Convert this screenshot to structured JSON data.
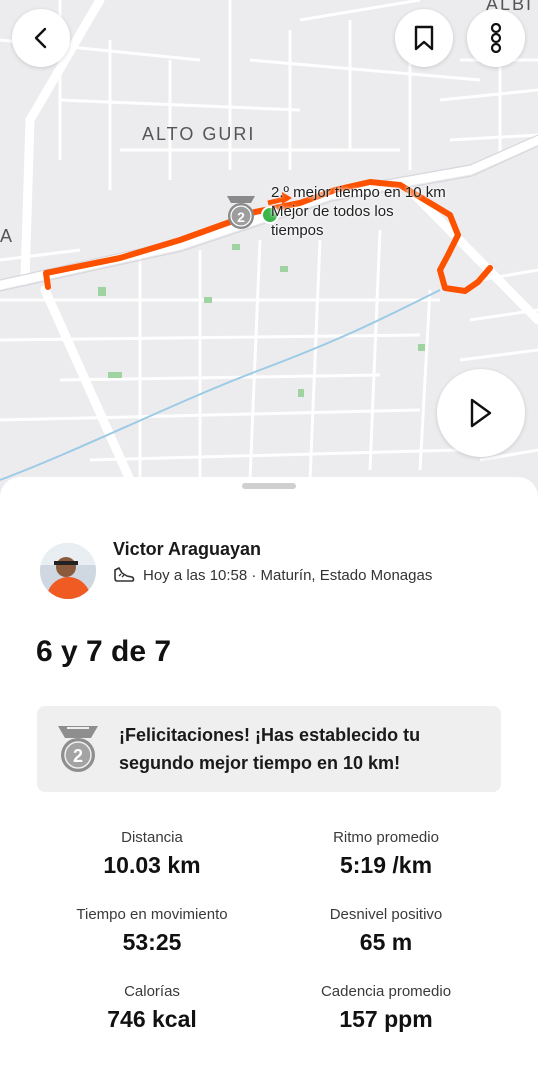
{
  "map": {
    "labels": {
      "alto_guri": "ALTO GURI",
      "albi": "ALBI",
      "a": "A"
    },
    "pr_callout": {
      "line1": "2.º mejor tiempo en 10 km",
      "line2": "Mejor de todos los",
      "line3": "tiempos"
    },
    "route_color": "#fc5200",
    "icons": {
      "back": "chevron-left-icon",
      "bookmark": "bookmark-icon",
      "more": "more-vertical-icon",
      "play": "play-icon"
    }
  },
  "athlete": {
    "name": "Victor Araguayan",
    "meta": "Hoy a las 10:58 · Maturín, Estado Monagas",
    "sport_icon": "shoe-icon"
  },
  "activity": {
    "title": "6 y 7 de 7"
  },
  "achievement": {
    "line1": "¡Felicitaciones! ¡Has establecido tu",
    "line2": "segundo mejor tiempo en 10 km!",
    "medal_number": "2"
  },
  "stats": [
    {
      "label": "Distancia",
      "value": "10.03 km"
    },
    {
      "label": "Ritmo promedio",
      "value": "5:19 /km"
    },
    {
      "label": "Tiempo en movimiento",
      "value": "53:25"
    },
    {
      "label": "Desnivel positivo",
      "value": "65 m"
    },
    {
      "label": "Calorías",
      "value": "746 kcal"
    },
    {
      "label": "Cadencia promedio",
      "value": "157 ppm"
    }
  ]
}
